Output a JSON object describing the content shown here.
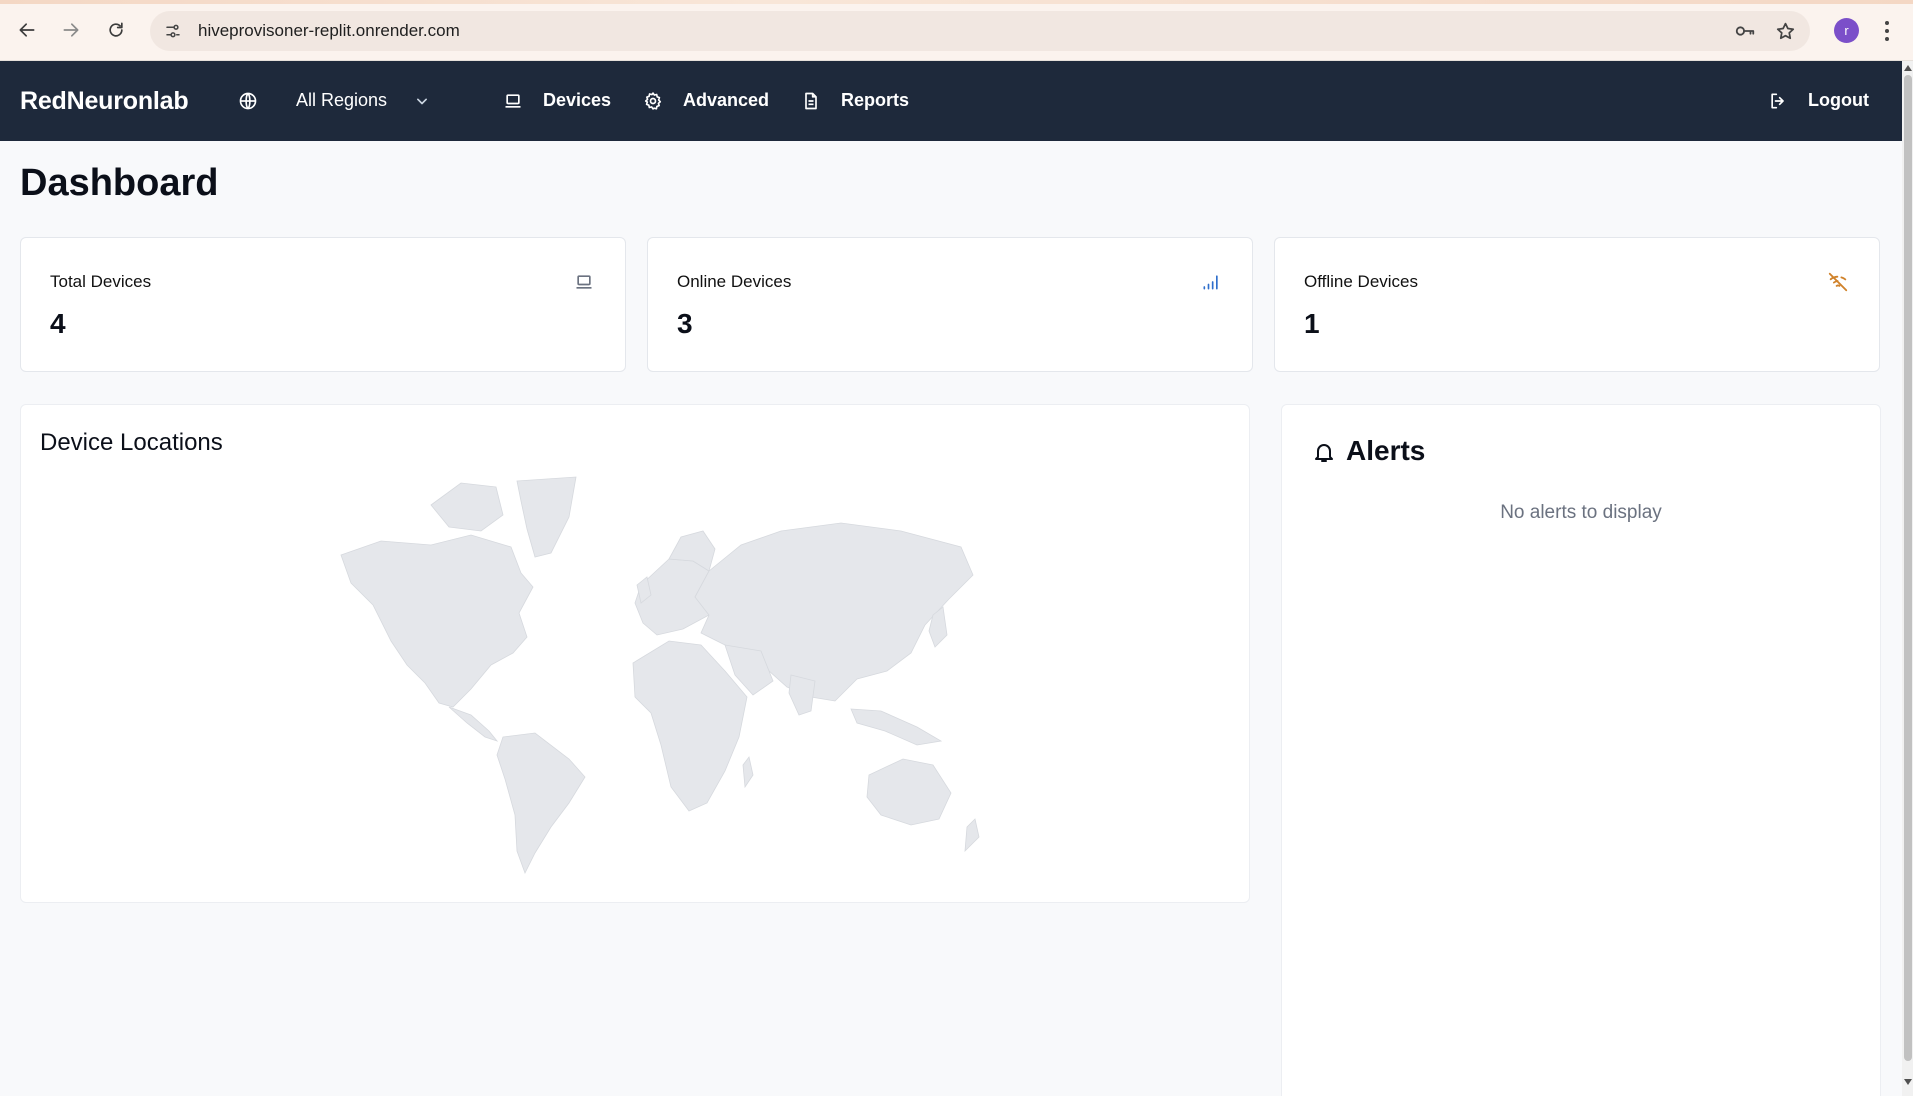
{
  "browser": {
    "url": "hiveprovisoner-replit.onrender.com",
    "profile_initial": "r",
    "icons": [
      "back-icon",
      "forward-icon",
      "reload-icon",
      "site-settings-icon",
      "password-key-icon",
      "bookmark-star-icon",
      "menu-dots-icon"
    ]
  },
  "nav": {
    "brand": "RedNeuronlab",
    "region_label": "All Regions",
    "items": [
      {
        "label": "Devices",
        "icon": "laptop-icon"
      },
      {
        "label": "Advanced",
        "icon": "gear-icon"
      },
      {
        "label": "Reports",
        "icon": "document-icon"
      }
    ],
    "logout_label": "Logout"
  },
  "page": {
    "title": "Dashboard"
  },
  "stats": [
    {
      "label": "Total Devices",
      "value": "4",
      "icon": "laptop-icon",
      "icon_color": "#6b7280"
    },
    {
      "label": "Online Devices",
      "value": "3",
      "icon": "signal-icon",
      "icon_color": "#2f6fcc"
    },
    {
      "label": "Offline Devices",
      "value": "1",
      "icon": "wifi-off-icon",
      "icon_color": "#d0822a"
    }
  ],
  "locations": {
    "title": "Device Locations",
    "map_color": "#e5e7eb"
  },
  "alerts": {
    "title": "Alerts",
    "empty_text": "No alerts to display"
  },
  "colors": {
    "nav_bg": "#1e293b",
    "page_bg": "#f8f9fb"
  }
}
